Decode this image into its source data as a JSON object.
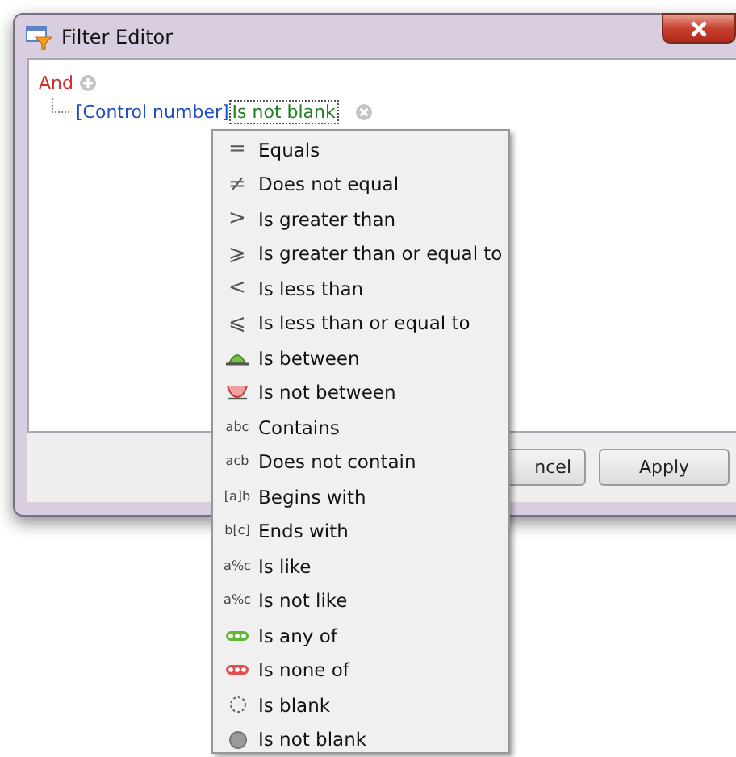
{
  "window": {
    "title": "Filter Editor"
  },
  "tree": {
    "group": "And",
    "condition": {
      "field": "[Control number]",
      "operator": "Is not blank"
    }
  },
  "menu": [
    {
      "label": "Equals",
      "kind": "symbol",
      "glyph": "="
    },
    {
      "label": "Does not equal",
      "kind": "symbol",
      "glyph": "≠"
    },
    {
      "label": "Is greater than",
      "kind": "symbol",
      "glyph": ">"
    },
    {
      "label": "Is greater than or equal to",
      "kind": "symbol",
      "glyph": "⩾"
    },
    {
      "label": "Is less than",
      "kind": "symbol",
      "glyph": "<"
    },
    {
      "label": "Is less than or equal to",
      "kind": "symbol",
      "glyph": "⩽"
    },
    {
      "label": "Is between",
      "kind": "between"
    },
    {
      "label": "Is not between",
      "kind": "not-between"
    },
    {
      "label": "Contains",
      "kind": "letters",
      "glyph": "abc"
    },
    {
      "label": "Does not contain",
      "kind": "letters",
      "glyph": "acb"
    },
    {
      "label": "Begins with",
      "kind": "letters",
      "glyph": "[a]b"
    },
    {
      "label": "Ends with",
      "kind": "letters",
      "glyph": "b[c]"
    },
    {
      "label": "Is like",
      "kind": "letters",
      "glyph": "a%c"
    },
    {
      "label": "Is not like",
      "kind": "letters",
      "glyph": "a%c"
    },
    {
      "label": "Is any of",
      "kind": "any-of"
    },
    {
      "label": "Is none of",
      "kind": "none-of"
    },
    {
      "label": "Is blank",
      "kind": "blank"
    },
    {
      "label": "Is not blank",
      "kind": "not-blank"
    }
  ],
  "buttons": [
    {
      "label": "ncel"
    },
    {
      "label": "Apply"
    }
  ]
}
